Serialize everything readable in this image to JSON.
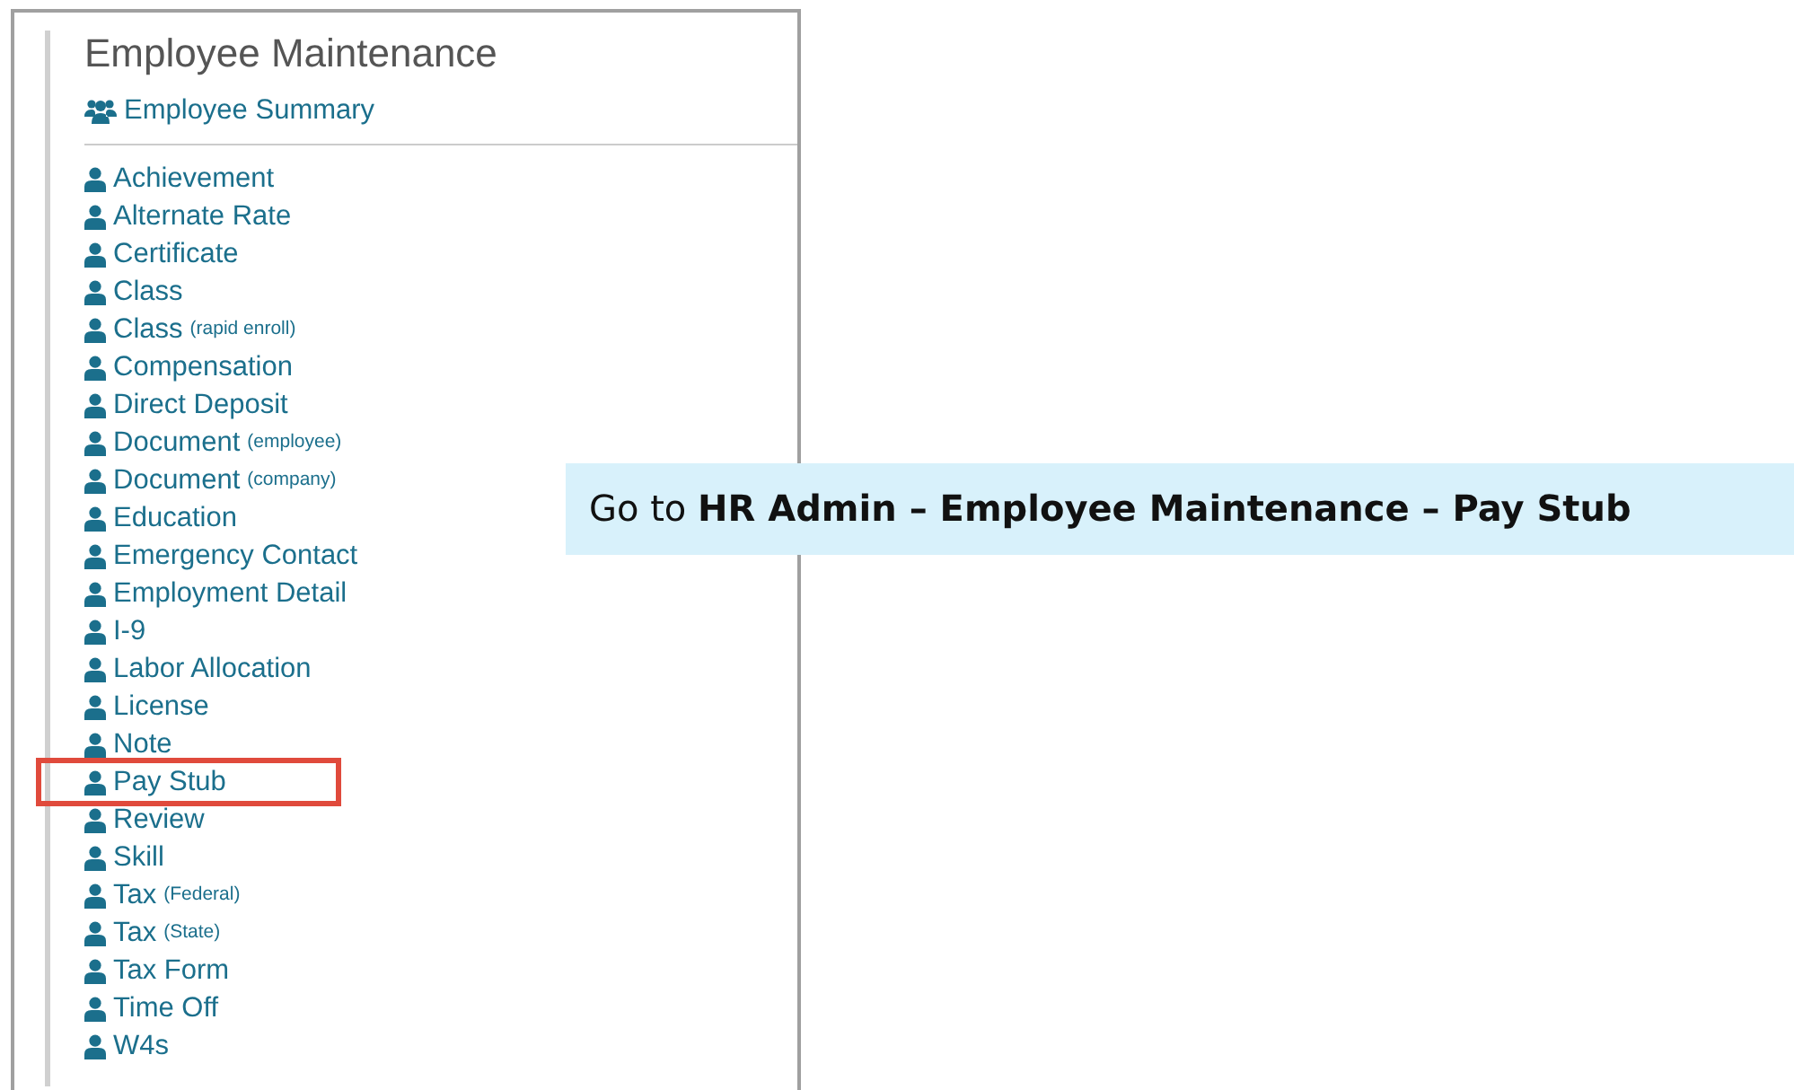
{
  "panel": {
    "title": "Employee Maintenance",
    "summary_link": "Employee Summary",
    "items": [
      {
        "label": "Achievement",
        "highlighted": false
      },
      {
        "label": "Alternate Rate",
        "highlighted": false
      },
      {
        "label": "Certificate",
        "highlighted": false
      },
      {
        "label": "Class",
        "highlighted": false
      },
      {
        "label": "Class",
        "note": "(rapid enroll)",
        "highlighted": false
      },
      {
        "label": "Compensation",
        "highlighted": false
      },
      {
        "label": "Direct Deposit",
        "highlighted": false
      },
      {
        "label": "Document",
        "note": "(employee)",
        "highlighted": false
      },
      {
        "label": "Document",
        "note": "(company)",
        "highlighted": false
      },
      {
        "label": "Education",
        "highlighted": false
      },
      {
        "label": "Emergency Contact",
        "highlighted": false
      },
      {
        "label": "Employment Detail",
        "highlighted": false
      },
      {
        "label": "I-9",
        "highlighted": false
      },
      {
        "label": "Labor Allocation",
        "highlighted": false
      },
      {
        "label": "License",
        "highlighted": false
      },
      {
        "label": "Note",
        "highlighted": false
      },
      {
        "label": "Pay Stub",
        "highlighted": true
      },
      {
        "label": "Review",
        "highlighted": false
      },
      {
        "label": "Skill",
        "highlighted": false
      },
      {
        "label": "Tax",
        "note": "(Federal)",
        "highlighted": false
      },
      {
        "label": "Tax",
        "note": "(State)",
        "highlighted": false
      },
      {
        "label": "Tax Form",
        "highlighted": false
      },
      {
        "label": "Time Off",
        "highlighted": false
      },
      {
        "label": "W4s",
        "highlighted": false
      }
    ]
  },
  "callout": {
    "text": "Go to **HR Admin – Employee Maintenance – Pay Stub**"
  }
}
